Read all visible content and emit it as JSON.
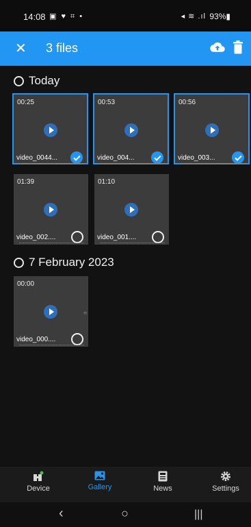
{
  "status_bar": {
    "time": "14:08",
    "left_icons": "▣ ♥ ⌗ •",
    "right_icons": "◂ ≋ .ıl",
    "battery": "93%"
  },
  "app_bar": {
    "title": "3 files",
    "color": "#2196f3"
  },
  "sections": [
    {
      "label": "Today",
      "items": [
        {
          "duration": "00:25",
          "name": "video_0044...",
          "selected": true
        },
        {
          "duration": "00:53",
          "name": "video_004...",
          "selected": true
        },
        {
          "duration": "00:56",
          "name": "video_003...",
          "selected": true
        },
        {
          "duration": "01:39",
          "name": "video_002....",
          "selected": false
        },
        {
          "duration": "01:10",
          "name": "video_001....",
          "selected": false
        }
      ]
    },
    {
      "label": "7 February 2023",
      "items": [
        {
          "duration": "00:00",
          "name": "video_000....",
          "selected": false
        }
      ]
    }
  ],
  "bottom_nav": [
    {
      "label": "Device",
      "icon": "device-icon",
      "active": false
    },
    {
      "label": "Gallery",
      "icon": "gallery-icon",
      "active": true
    },
    {
      "label": "News",
      "icon": "news-icon",
      "active": false
    },
    {
      "label": "Settings",
      "icon": "gear-icon",
      "active": false
    }
  ],
  "system_nav": {
    "back": "‹",
    "home": "○",
    "recents": "|||"
  }
}
